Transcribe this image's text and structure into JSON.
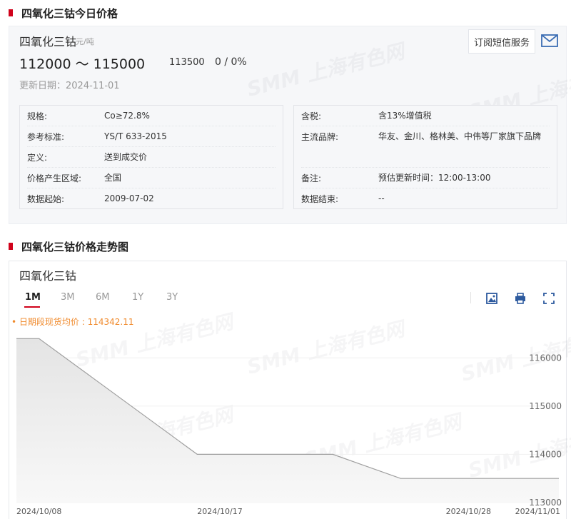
{
  "sections": {
    "today_title": "四氧化三钴今日价格",
    "trend_title": "四氧化三钴价格走势图"
  },
  "price": {
    "product_name": "四氧化三钴",
    "unit": "元/吨",
    "range": "112000 ～ 115000",
    "average": "113500",
    "change": "0  /  0%",
    "update_date": "更新日期：2024-11-01",
    "subscribe_label": "订阅短信服务",
    "icon": "mail-icon"
  },
  "specs_left": [
    {
      "key": "规格:",
      "value": "Co≥72.8%"
    },
    {
      "key": "参考标准:",
      "value": "YS/T 633-2015"
    },
    {
      "key": "定义:",
      "value": "送到成交价"
    },
    {
      "key": "价格产生区域:",
      "value": "全国"
    },
    {
      "key": "数据起始:",
      "value": "2009-07-02"
    }
  ],
  "specs_right": [
    {
      "key": "含税:",
      "value": "含13%增值税"
    },
    {
      "key": "主流品牌:",
      "value": "华友、金川、格林美、中伟等厂家旗下品牌"
    },
    {
      "key": "备注:",
      "value": "预估更新时间：12:00-13:00"
    },
    {
      "key": "数据结束:",
      "value": "--"
    }
  ],
  "watermark_text": "SMM 上海有色网",
  "chart": {
    "name": "四氧化三钴",
    "tabs": [
      "1M",
      "3M",
      "6M",
      "1Y",
      "3Y"
    ],
    "active_tab": "1M",
    "avg_label": "• 日期段现货均价 : 114342.11",
    "tools": [
      "image-download-icon",
      "print-icon",
      "fullscreen-icon"
    ]
  },
  "chart_data": {
    "type": "area",
    "series": [
      {
        "values": [
          {
            "x": "2024-10-08",
            "y": 116400
          },
          {
            "x": "2024-10-09",
            "y": 116400
          },
          {
            "x": "2024-10-16",
            "y": 114000
          },
          {
            "x": "2024-10-22",
            "y": 114000
          },
          {
            "x": "2024-10-25",
            "y": 113500
          },
          {
            "x": "2024-11-01",
            "y": 113500
          }
        ]
      }
    ],
    "x_ticks": [
      "2024/10/08",
      "2024/10/17",
      "2024/10/28",
      "2024/11/01"
    ],
    "y_ticks": [
      113000,
      114000,
      115000,
      116000
    ],
    "ylim": [
      113000,
      116700
    ],
    "color": "#9e9e9e",
    "fill": "#eeeeee",
    "grid": "horizontal, light"
  }
}
